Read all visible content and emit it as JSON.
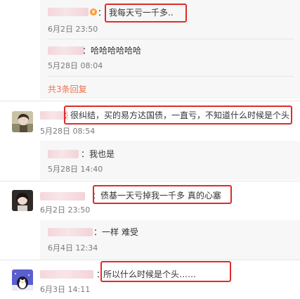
{
  "comments": [
    {
      "text": "我每天亏一千多..",
      "time": "6月2日 23:50",
      "colon": "："
    },
    {
      "text": "哈哈哈哈哈哈",
      "time": "5月28日 08:04",
      "colon": "："
    },
    {
      "text": "很纠结，买的易方达国债，一直亏，不知道什么时候是个头",
      "time": "5月28日 08:54",
      "colon": "："
    },
    {
      "text": "我也是",
      "time": "5月28日 14:40",
      "colon": "："
    },
    {
      "text": "债基一天亏掉我一千多 真的心塞",
      "time": "6月2日 23:50",
      "colon": "："
    },
    {
      "text": "一样 难受",
      "time": "6月4日 12:34",
      "colon": "："
    },
    {
      "text": "所以什么时候是个头……",
      "time": "6月3日 14:11",
      "colon": "："
    }
  ],
  "more_replies_label": "共3条回复",
  "colors": {
    "highlight": "#e02b2b",
    "link": "#eb7350",
    "reply_bg": "#f7f7f7",
    "meta": "#7a7a7a"
  },
  "icons": [
    "badge-icon",
    "avatar-girl-icon",
    "avatar-woman-icon",
    "avatar-penguin-icon"
  ]
}
